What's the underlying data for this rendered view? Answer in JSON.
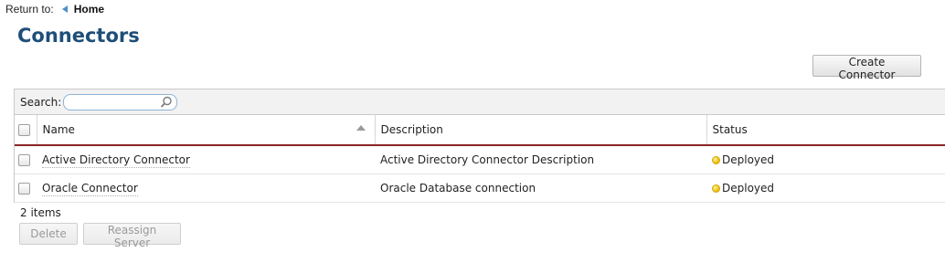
{
  "return_bar": {
    "label": "Return to:",
    "home_label": "Home"
  },
  "page_title": "Connectors",
  "toolbar": {
    "create_label": "Create Connector"
  },
  "search": {
    "label": "Search:",
    "value": "",
    "placeholder": ""
  },
  "table": {
    "columns": {
      "name": "Name",
      "description": "Description",
      "status": "Status"
    },
    "sort": {
      "column": "name",
      "direction": "ascending"
    },
    "rows": [
      {
        "name": "Active Directory Connector",
        "description": "Active Directory Connector Description",
        "status": "Deployed"
      },
      {
        "name": "Oracle Connector",
        "description": "Oracle Database connection",
        "status": "Deployed"
      }
    ]
  },
  "footer": {
    "items_count": "2 items",
    "delete_label": "Delete",
    "reassign_label": "Reassign Server"
  },
  "colors": {
    "title": "#1f4e79",
    "header_rule": "#8b2323",
    "status_deployed": "#e9b800"
  }
}
